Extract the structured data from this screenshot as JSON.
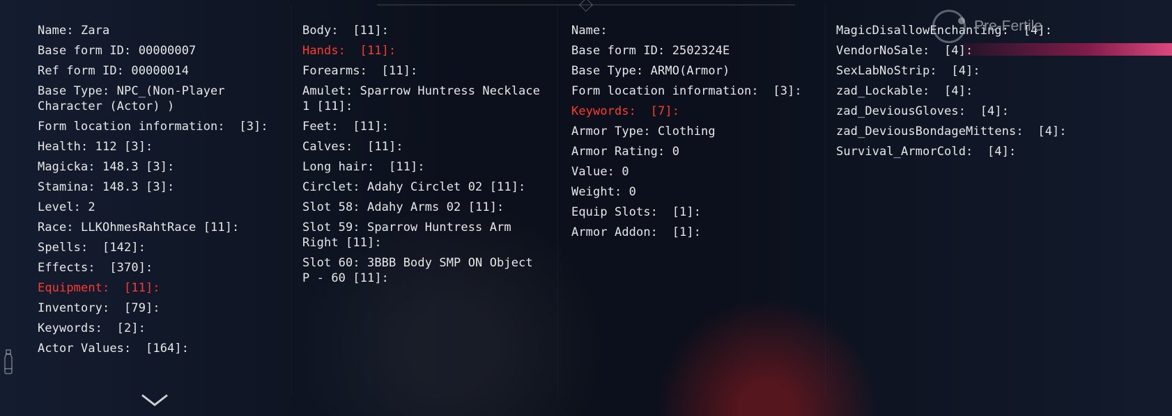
{
  "hud": {
    "status_label": "Pre-Fertile"
  },
  "col1": [
    {
      "text": "Name: Zara"
    },
    {
      "text": "Base form ID: 00000007"
    },
    {
      "text": "Ref form ID: 00000014"
    },
    {
      "text": "Base Type: NPC_(Non-Player Character (Actor) )",
      "wrap": true
    },
    {
      "text": "Form location information:  [3]:"
    },
    {
      "text": "Health: 112 [3]:"
    },
    {
      "text": "Magicka: 148.3 [3]:"
    },
    {
      "text": "Stamina: 148.3 [3]:"
    },
    {
      "text": "Level: 2"
    },
    {
      "text": "Race: LLKOhmesRahtRace [11]:"
    },
    {
      "text": "Spells:  [142]:"
    },
    {
      "text": "Effects:  [370]:"
    },
    {
      "text": "Equipment:  [11]:",
      "hi": true
    },
    {
      "text": "Inventory:  [79]:"
    },
    {
      "text": "Keywords:  [2]:"
    },
    {
      "text": "Actor Values:  [164]:"
    }
  ],
  "col2": [
    {
      "text": "Body:  [11]:"
    },
    {
      "text": "Hands:  [11]:",
      "hi": true
    },
    {
      "text": "Forearms:  [11]:"
    },
    {
      "text": "Amulet: Sparrow Huntress Necklace 1 [11]:",
      "wrap": true
    },
    {
      "text": "Feet:  [11]:"
    },
    {
      "text": "Calves:  [11]:"
    },
    {
      "text": "Long hair:  [11]:"
    },
    {
      "text": "Circlet: Adahy Circlet 02 [11]:"
    },
    {
      "text": "Slot 58: Adahy Arms 02 [11]:"
    },
    {
      "text": "Slot 59: Sparrow Huntress Arm Right [11]:",
      "wrap": true
    },
    {
      "text": "Slot 60: 3BBB Body SMP ON Object P - 60 [11]:",
      "wrap": true
    }
  ],
  "col3": [
    {
      "text": "Name:"
    },
    {
      "text": "Base form ID: 2502324E"
    },
    {
      "text": "Base Type: ARMO(Armor)"
    },
    {
      "text": "Form location information:  [3]:"
    },
    {
      "text": "Keywords:  [7]:",
      "hi": true
    },
    {
      "text": "Armor Type: Clothing"
    },
    {
      "text": "Armor Rating: 0"
    },
    {
      "text": "Value: 0"
    },
    {
      "text": "Weight: 0"
    },
    {
      "text": "Equip Slots:  [1]:"
    },
    {
      "text": "Armor Addon:  [1]:"
    }
  ],
  "col4": [
    {
      "text": "MagicDisallowEnchanting:  [4]:"
    },
    {
      "text": "VendorNoSale:  [4]:"
    },
    {
      "text": "SexLabNoStrip:  [4]:"
    },
    {
      "text": "zad_Lockable:  [4]:"
    },
    {
      "text": "zad_DeviousGloves:  [4]:"
    },
    {
      "text": "zad_DeviousBondageMittens:  [4]:"
    },
    {
      "text": "Survival_ArmorCold:  [4]:"
    }
  ]
}
